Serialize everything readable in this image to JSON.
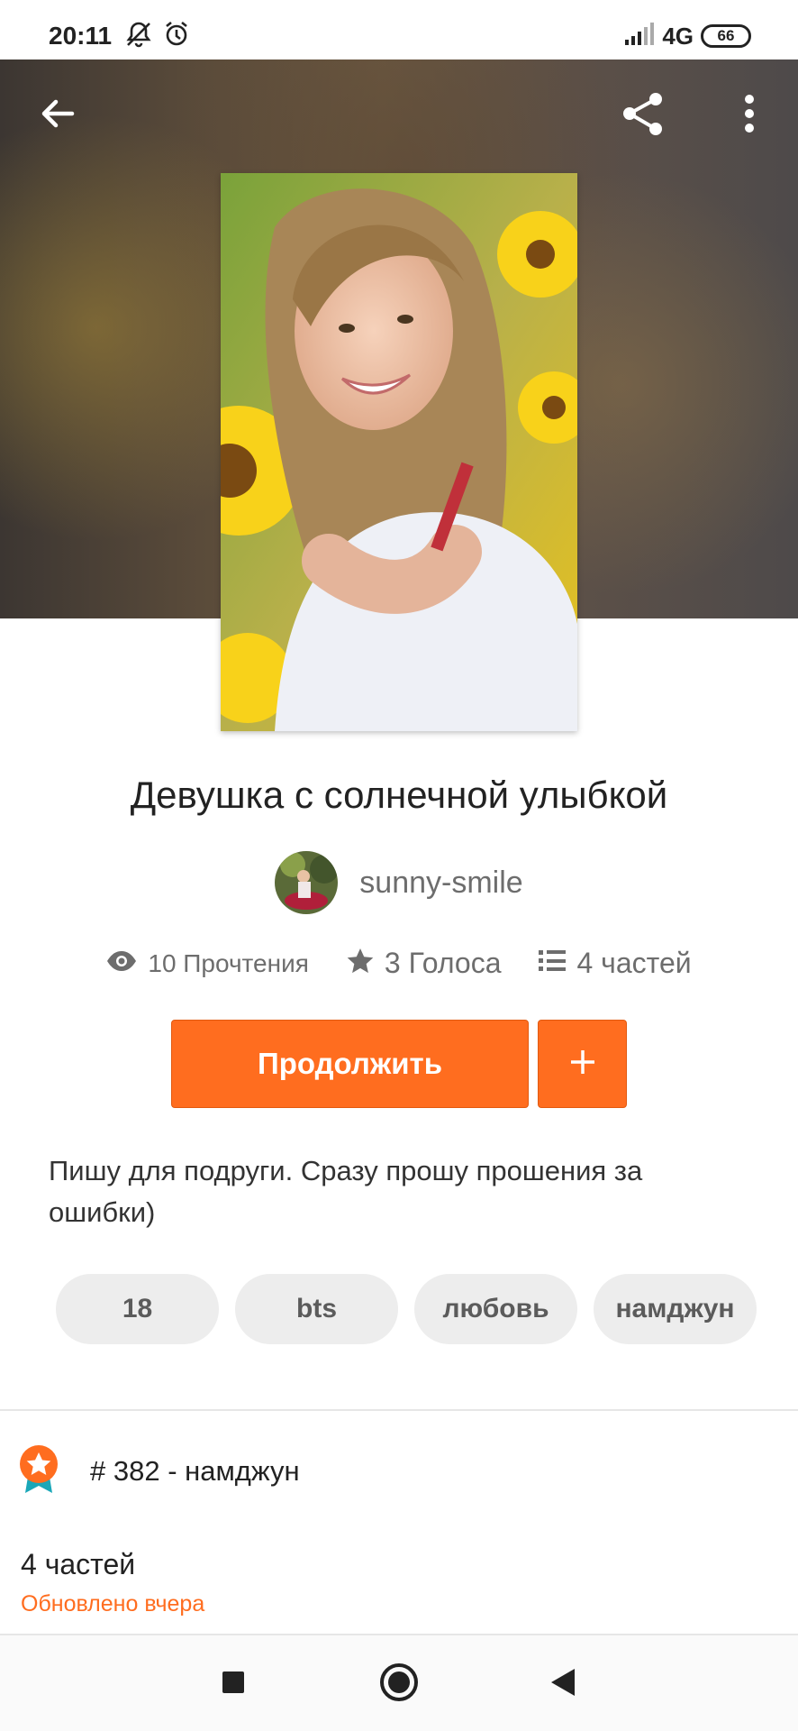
{
  "status_bar": {
    "time": "20:11",
    "icons": [
      "notifications-off-icon",
      "alarm-icon",
      "signal-icon"
    ],
    "network": "4G",
    "battery": "66"
  },
  "header": {
    "back_icon": "arrow-left-icon",
    "share_icon": "share-icon",
    "more_icon": "more-vert-icon"
  },
  "story": {
    "title": "Девушка с солнечной улыбкой",
    "author": "sunny-smile",
    "stats": {
      "reads": "10 Прочтения",
      "votes": "3 Голоса",
      "parts": "4 частей"
    },
    "continue_label": "Продолжить",
    "add_label": "+",
    "description": "Пишу для подруги. Сразу прошу прошения за ошибки)",
    "tags": [
      "18",
      "bts",
      "любовь",
      "намджун"
    ]
  },
  "ranking": {
    "text": "# 382 - намджун",
    "icon": "rank-badge-icon"
  },
  "parts_section": {
    "count": "4 частей",
    "updated": "Обновлено вчера"
  },
  "colors": {
    "accent": "#ff6d1f",
    "tag_bg": "#ededed",
    "muted_text": "#6d6d6d"
  },
  "nav_bar": {
    "icons": [
      "recents-square-icon",
      "home-circle-icon",
      "back-triangle-icon"
    ]
  }
}
